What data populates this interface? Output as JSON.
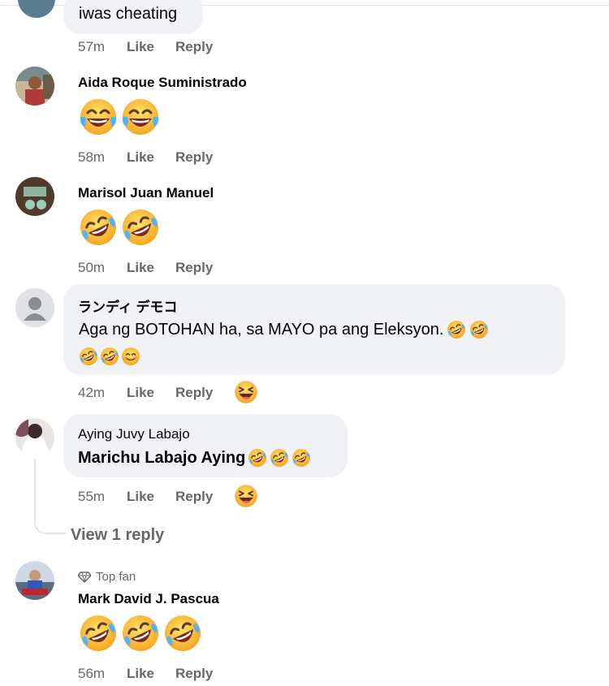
{
  "top_comment": {
    "text": "iwas cheating",
    "time": "57m",
    "like": "Like",
    "reply": "Reply"
  },
  "comments": [
    {
      "name": "Aida Roque Suministrado",
      "time": "58m",
      "like": "Like",
      "reply": "Reply",
      "emoji": "laughing-tears"
    },
    {
      "name": "Marisol Juan Manuel",
      "time": "50m",
      "like": "Like",
      "reply": "Reply",
      "emoji": "rofl"
    },
    {
      "name": "ランディ デモコ",
      "text": "Aga ng BOTOHAN ha, sa MAYO pa ang Eleksyon.",
      "time": "42m",
      "like": "Like",
      "reply": "Reply"
    },
    {
      "name": "Aying Juvy Labajo",
      "text": "Marichu Labajo Aying",
      "time": "55m",
      "like": "Like",
      "reply": "Reply"
    },
    {
      "badge": "Top fan",
      "name": "Mark David J. Pascua",
      "time": "56m",
      "like": "Like",
      "reply": "Reply",
      "emoji": "rofl"
    }
  ],
  "view_replies": "View 1 reply",
  "colors": {
    "bubble": "#f0f2f5",
    "meta": "#65676b",
    "text": "#050505",
    "haha": "#f7b125"
  }
}
